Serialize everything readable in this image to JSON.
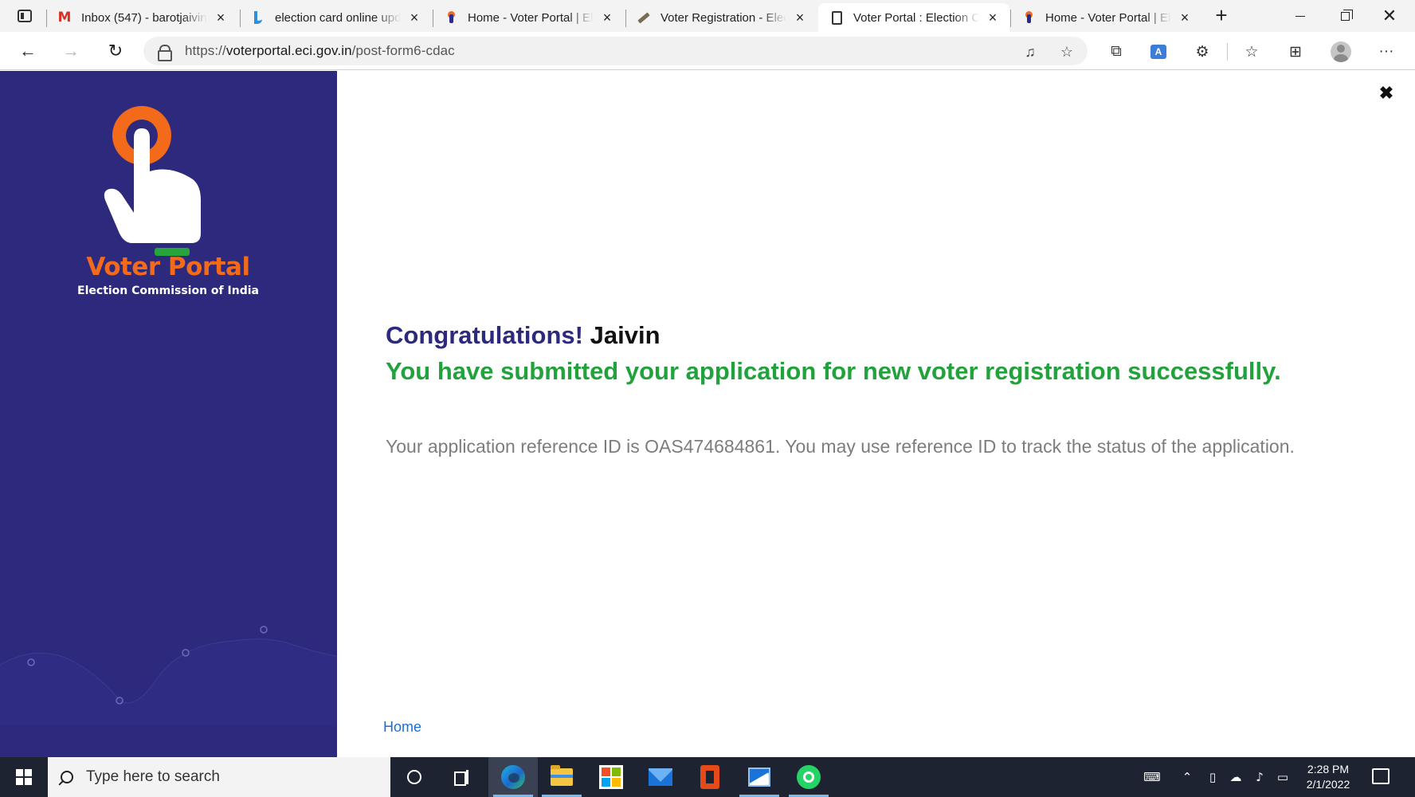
{
  "browser": {
    "tabs": [
      {
        "title": "Inbox (547) - barotjaivin",
        "favicon": "gmail-icon"
      },
      {
        "title": "election card online upd",
        "favicon": "bing-icon"
      },
      {
        "title": "Home - Voter Portal | Ele",
        "favicon": "voter-portal-icon"
      },
      {
        "title": "Voter Registration - Elec",
        "favicon": "pencil-icon"
      },
      {
        "title": "Voter Portal : Election Co",
        "favicon": "page-icon",
        "active": true
      },
      {
        "title": "Home - Voter Portal | Ele",
        "favicon": "voter-portal-icon"
      }
    ],
    "url_scheme": "https://",
    "url_host": "voterportal.eci.gov.in",
    "url_path": "/post-form6-cdac"
  },
  "sidebar": {
    "brand_first_letter": "V",
    "brand_rest": "oter Portal",
    "subtitle": "Election Commission of India"
  },
  "main": {
    "congrats_label": "Congratulations!",
    "user_name": "Jaivin",
    "success_message": "You have submitted your application for new voter registration successfully.",
    "reference_message": "Your application reference ID is OAS474684861. You may use reference ID to track the status of the application.",
    "home_link": "Home"
  },
  "taskbar": {
    "search_placeholder": "Type here to search",
    "time": "2:28 PM",
    "date": "2/1/2022"
  },
  "colors": {
    "sidebar_bg": "#2d2a7e",
    "brand_orange": "#f36a1b",
    "success_green": "#22a23c",
    "link_blue": "#1a6fd6"
  }
}
